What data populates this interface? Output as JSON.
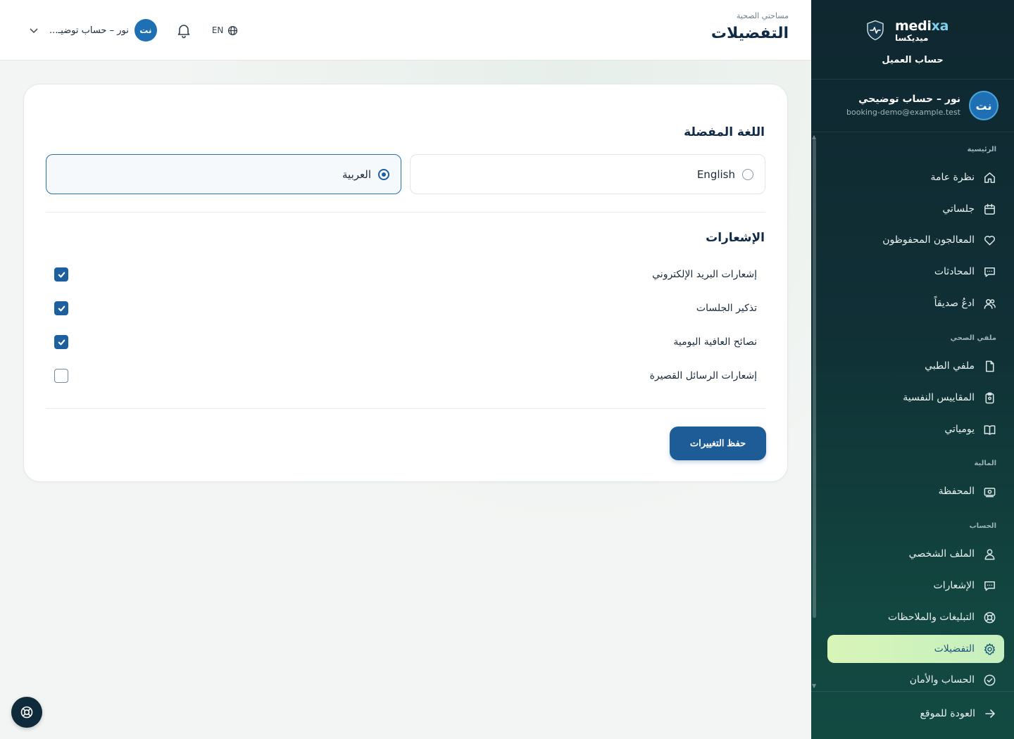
{
  "brand": {
    "name_prefix": "medi",
    "name_suffix": "xa",
    "name_arabic": "ميديكسا",
    "account_label": "حساب العميل"
  },
  "user": {
    "initials": "نت",
    "name": "نور – حساب توضيحي",
    "email": "booking-demo@example.test",
    "short_name": "نور – حساب توضيـ..."
  },
  "sidebar": {
    "sections": [
      {
        "label": "الرئيسية"
      },
      {
        "label": "ملفي الصحي"
      },
      {
        "label": "المالية"
      },
      {
        "label": "الحساب"
      }
    ],
    "items": [
      {
        "label": "نظرة عامة",
        "icon": "home-icon"
      },
      {
        "label": "جلساتي",
        "icon": "calendar-icon"
      },
      {
        "label": "المعالجون المحفوظون",
        "icon": "heart-icon"
      },
      {
        "label": "المحادثات",
        "icon": "chat-icon"
      },
      {
        "label": "ادعُ صديقاً",
        "icon": "users-icon"
      },
      {
        "label": "ملفي الطبي",
        "icon": "file-icon"
      },
      {
        "label": "المقاييس النفسية",
        "icon": "clipboard-icon"
      },
      {
        "label": "يومياتي",
        "icon": "book-icon"
      },
      {
        "label": "المحفظة",
        "icon": "wallet-icon"
      },
      {
        "label": "الملف الشخصي",
        "icon": "user-icon"
      },
      {
        "label": "الإشعارات",
        "icon": "message-icon"
      },
      {
        "label": "التبليغات والملاحظات",
        "icon": "lifebuoy-icon"
      },
      {
        "label": "التفضيلات",
        "icon": "gear-icon",
        "active": true
      },
      {
        "label": "الحساب والأمان",
        "icon": "check-circle-icon"
      }
    ],
    "back_label": "العودة للموقع"
  },
  "header": {
    "breadcrumb": "مساحتي الصحية",
    "title": "التفضيلات",
    "lang_code": "EN"
  },
  "preferences": {
    "language_title": "اللغة المفضلة",
    "languages": [
      {
        "label": "العربية",
        "selected": true
      },
      {
        "label": "English",
        "selected": false
      }
    ],
    "notifications_title": "الإشعارات",
    "notifications": [
      {
        "label": "إشعارات البريد الإلكتروني",
        "checked": true
      },
      {
        "label": "تذكير الجلسات",
        "checked": true
      },
      {
        "label": "نصائح العافية اليومية",
        "checked": true
      },
      {
        "label": "إشعارات الرسائل القصيرة",
        "checked": false
      }
    ],
    "save_label": "حفظ التغييرات"
  },
  "colors": {
    "accent": "#1e5c97",
    "sidebar_dark": "#0f2730",
    "active_item": "#d8f5b8"
  }
}
